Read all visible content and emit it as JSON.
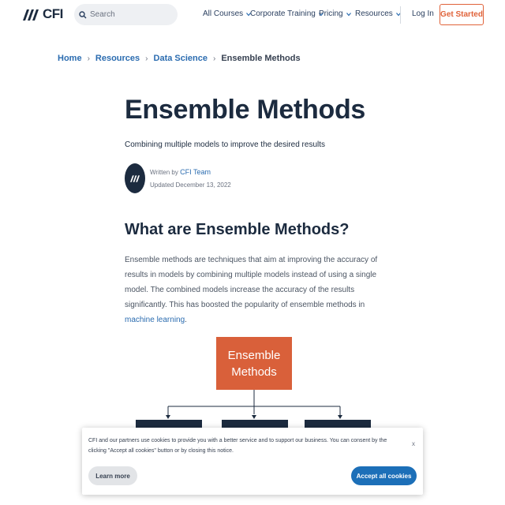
{
  "header": {
    "logo_text": "CFI",
    "search_placeholder": "Search",
    "nav": [
      {
        "label": "All Courses"
      },
      {
        "label": "Corporate Training"
      },
      {
        "label": "Pricing"
      },
      {
        "label": "Resources"
      }
    ],
    "login_label": "Log In",
    "cta_label": "Get Started"
  },
  "breadcrumb": {
    "items": [
      "Home",
      "Resources",
      "Data Science"
    ],
    "current": "Ensemble Methods"
  },
  "article": {
    "title": "Ensemble Methods",
    "subtitle": "Combining multiple models to improve the desired results",
    "written_by_prefix": "Written by",
    "author": "CFI Team",
    "updated": "Updated December 13, 2022",
    "section_heading": "What are Ensemble Methods?",
    "paragraph_text": "Ensemble methods are techniques that aim at improving the accuracy of results in models by combining multiple models instead of using a single model. The combined models increase the accuracy of the results significantly. This has boosted the popularity of ensemble methods in ",
    "paragraph_link": "machine learning",
    "paragraph_end": "."
  },
  "diagram": {
    "root_line1": "Ensemble",
    "root_line2": "Methods"
  },
  "cookie": {
    "text": "CFI and our partners use cookies to provide you with a better service and to support our business. You can consent by the clicking \"Accept all cookies\" button or by closing this notice.",
    "close_label": "x",
    "learn_more_label": "Learn more",
    "accept_label": "Accept all cookies"
  },
  "colors": {
    "brand_navy": "#1c2b3f",
    "accent_orange": "#d9603a",
    "link_blue": "#2b6cb0",
    "accept_blue": "#1c6fb8"
  },
  "icons": {
    "search": "search-icon",
    "chevron": "chevron-down-icon",
    "logo": "cfi-logo-icon"
  }
}
